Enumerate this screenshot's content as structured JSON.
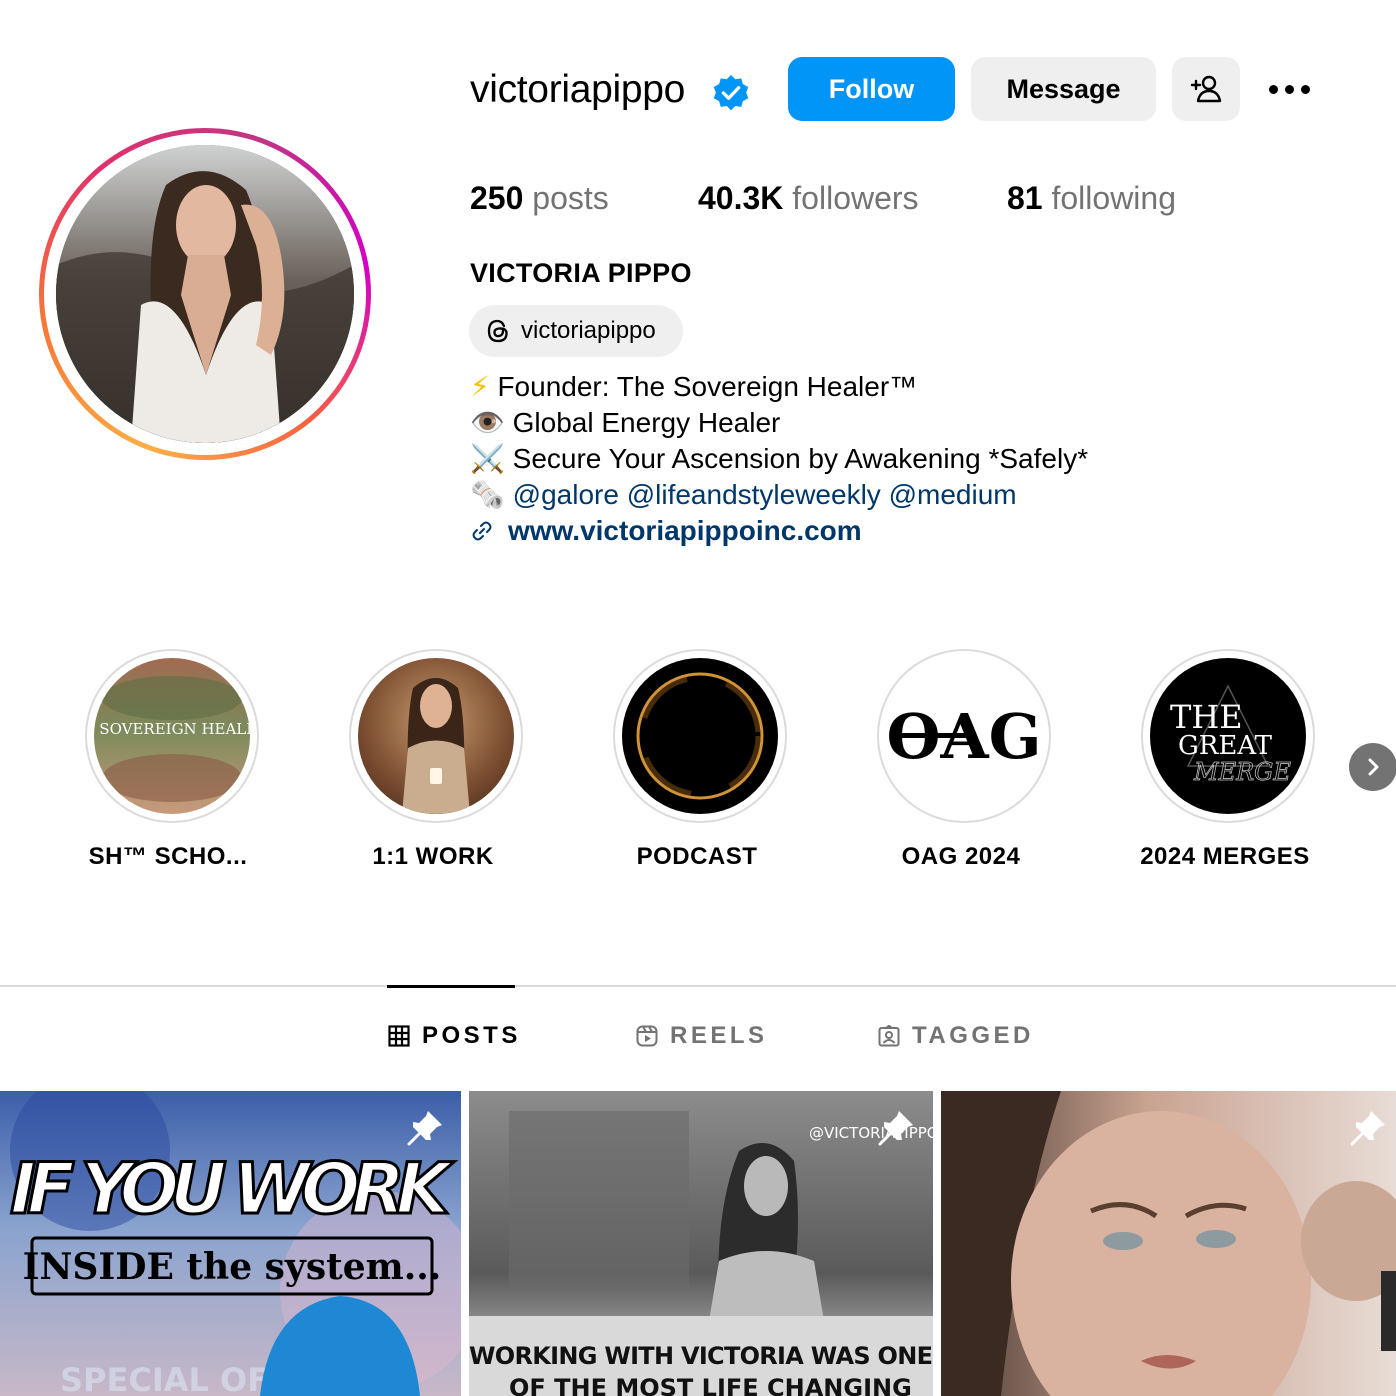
{
  "profile": {
    "username": "victoriapippo",
    "full_name": "VICTORIA PIPPO",
    "verified": true,
    "threads_handle": "victoriapippo"
  },
  "actions": {
    "follow_label": "Follow",
    "message_label": "Message"
  },
  "stats": {
    "posts_count": "250",
    "posts_label": "posts",
    "followers_count": "40.3K",
    "followers_label": "followers",
    "following_count": "81",
    "following_label": "following"
  },
  "bio": {
    "line1_emoji": "⚡",
    "line1_text": "Founder: The Sovereign Healer™",
    "line2_emoji": "👁️",
    "line2_text": "Global Energy Healer",
    "line3_emoji": "⚔️",
    "line3_text": "Secure Your Ascension by Awakening *Safely*",
    "line4_emoji": "🗞️",
    "mentions": [
      "@galore",
      "@lifeandstyleweekly",
      "@medium"
    ],
    "website": "www.victoriapippoinc.com"
  },
  "highlights": [
    {
      "label": "SH™ SCHO...",
      "image_text": "THE SOVEREIGN HEALER™"
    },
    {
      "label": "1:1 WORK"
    },
    {
      "label": "PODCAST"
    },
    {
      "label": "OAG 2024",
      "image_text": "OAG"
    },
    {
      "label": "2024 MERGES",
      "image_text_1": "THE",
      "image_text_2": "GREAT",
      "image_text_3": "MERGE"
    }
  ],
  "tabs": [
    {
      "label": "POSTS",
      "icon": "grid-icon",
      "active": true
    },
    {
      "label": "REELS",
      "icon": "reels-icon",
      "active": false
    },
    {
      "label": "TAGGED",
      "icon": "tagged-icon",
      "active": false
    }
  ],
  "posts": [
    {
      "pinned": true,
      "headline": "IF YOU WORK",
      "subline": "INSIDE the system...",
      "badge": "SPECIAL OFFER"
    },
    {
      "pinned": true,
      "watermark": "@VICTORIAPIPPO",
      "caption_1": "WORKING WITH VICTORIA WAS ONE",
      "caption_2": "OF THE MOST LIFE CHANGING"
    },
    {
      "pinned": true
    }
  ],
  "colors": {
    "accent": "#0095f6",
    "link": "#00376b",
    "secondary_text": "#737373",
    "button_gray": "#efefef"
  }
}
